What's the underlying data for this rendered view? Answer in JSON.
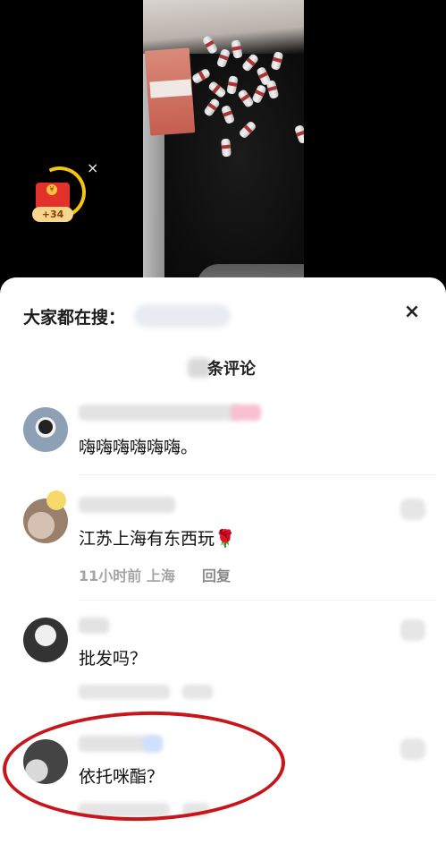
{
  "video": {
    "redpacket": {
      "coin_text": "¥",
      "badge": "+34"
    },
    "close_glyph": "×"
  },
  "panel": {
    "hot_search_label": "大家都在搜：",
    "close_glyph": "×",
    "comment_count_label": "条评论"
  },
  "comments": [
    {
      "text": "嗨嗨嗨嗨嗨嗨。"
    },
    {
      "text": "江苏上海有东西玩🌹",
      "time": "11小时前 上海",
      "reply": "回复"
    },
    {
      "text": "批发吗？"
    },
    {
      "text": "依托咪酯？"
    }
  ],
  "colors": {
    "annotation": "#c8151b",
    "redpacket": "#e3312b"
  }
}
